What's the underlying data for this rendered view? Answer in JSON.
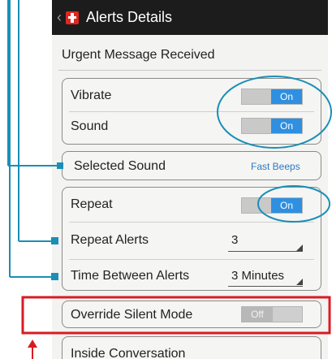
{
  "header": {
    "title": "Alerts Details"
  },
  "section_header": "Urgent Message Received",
  "settings": {
    "vibrate": {
      "label": "Vibrate",
      "state": "On"
    },
    "sound": {
      "label": "Sound",
      "state": "On"
    },
    "selected_sound": {
      "label": "Selected Sound",
      "value": "Fast Beeps"
    },
    "repeat": {
      "label": "Repeat",
      "state": "On"
    },
    "repeat_alerts": {
      "label": "Repeat Alerts",
      "value": "3"
    },
    "time_between_alerts": {
      "label": "Time Between Alerts",
      "value": "3 Minutes"
    },
    "override_silent_mode": {
      "label": "Override Silent Mode",
      "state": "Off"
    },
    "inside_conversation": {
      "label": "Inside Conversation"
    }
  },
  "colors": {
    "toggle_on": "#2f8fe0",
    "callout_blue": "#1a8fb6",
    "callout_red": "#d81b23",
    "titlebar": "#1c1c1c"
  }
}
